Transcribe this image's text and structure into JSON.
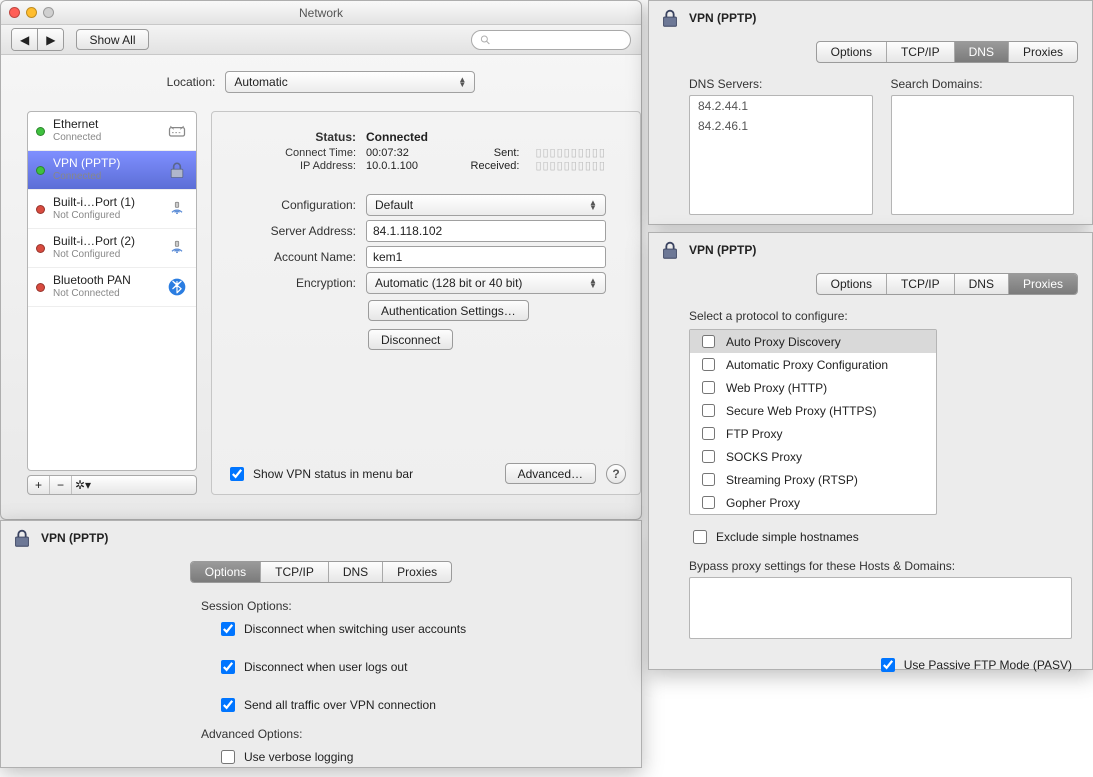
{
  "window": {
    "title": "Network"
  },
  "toolbar": {
    "show_all": "Show All",
    "search_placeholder": ""
  },
  "location": {
    "label": "Location:",
    "value": "Automatic"
  },
  "services": [
    {
      "dot": "green",
      "name": "Ethernet",
      "status": "Connected",
      "icon": "ethernet"
    },
    {
      "dot": "green",
      "name": "VPN (PPTP)",
      "status": "Connected",
      "icon": "lock",
      "selected": true
    },
    {
      "dot": "red",
      "name": "Built-i…Port (1)",
      "status": "Not Configured",
      "icon": "modem"
    },
    {
      "dot": "red",
      "name": "Built-i…Port (2)",
      "status": "Not Configured",
      "icon": "modem"
    },
    {
      "dot": "red",
      "name": "Bluetooth PAN",
      "status": "Not Connected",
      "icon": "bluetooth"
    }
  ],
  "detail": {
    "status_label": "Status:",
    "status_value": "Connected",
    "connect_time_label": "Connect Time:",
    "connect_time_value": "00:07:32",
    "ip_label": "IP Address:",
    "ip_value": "10.0.1.100",
    "sent_label": "Sent:",
    "received_label": "Received:",
    "config_label": "Configuration:",
    "config_value": "Default",
    "server_label": "Server Address:",
    "server_value": "84.1.118.102",
    "account_label": "Account Name:",
    "account_value": "kem1",
    "encryption_label": "Encryption:",
    "encryption_value": "Automatic (128 bit or 40 bit)",
    "auth_btn": "Authentication Settings…",
    "disconnect_btn": "Disconnect"
  },
  "footer": {
    "show_status": "Show VPN status in menu bar",
    "advanced_btn": "Advanced…"
  },
  "sheets": {
    "title": "VPN (PPTP)",
    "tabs": {
      "options": "Options",
      "tcpip": "TCP/IP",
      "dns": "DNS",
      "proxies": "Proxies"
    },
    "options": {
      "session_hdr": "Session Options:",
      "o1": "Disconnect when switching user accounts",
      "o2": "Disconnect when user logs out",
      "o3": "Send all traffic over VPN connection",
      "adv_hdr": "Advanced Options:",
      "o4": "Use verbose logging"
    },
    "dns": {
      "servers_label": "DNS Servers:",
      "servers": [
        "84.2.44.1",
        "84.2.46.1"
      ],
      "search_label": "Search Domains:"
    },
    "proxies": {
      "select_label": "Select a protocol to configure:",
      "protocols": [
        "Auto Proxy Discovery",
        "Automatic Proxy Configuration",
        "Web Proxy (HTTP)",
        "Secure Web Proxy (HTTPS)",
        "FTP Proxy",
        "SOCKS Proxy",
        "Streaming Proxy (RTSP)",
        "Gopher Proxy"
      ],
      "exclude": "Exclude simple hostnames",
      "bypass_label": "Bypass proxy settings for these Hosts & Domains:",
      "pasv": "Use Passive FTP Mode (PASV)"
    }
  }
}
